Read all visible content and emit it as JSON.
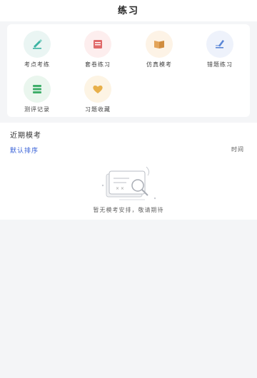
{
  "header": {
    "title": "练习"
  },
  "practice": {
    "tiles": [
      {
        "label": "考点考练",
        "icon": "pen-icon",
        "bg": "#eaf5f3",
        "color": "#3bb3a2"
      },
      {
        "label": "套卷练习",
        "icon": "book-icon",
        "bg": "#fdeeee",
        "color": "#e06a6a"
      },
      {
        "label": "仿真模考",
        "icon": "open-book-icon",
        "bg": "#fdf3e6",
        "color": "#e3a45a"
      },
      {
        "label": "错题练习",
        "icon": "edit-icon",
        "bg": "#eef2fb",
        "color": "#5a86d6"
      },
      {
        "label": "测评记录",
        "icon": "stack-icon",
        "bg": "#eaf6ee",
        "color": "#3fae6a"
      },
      {
        "label": "习题收藏",
        "icon": "heart-icon",
        "bg": "#fdf4e4",
        "color": "#e8b04a"
      }
    ]
  },
  "recent": {
    "title": "近期模考",
    "sort_label": "默认排序",
    "time_label": "时间",
    "empty_text": "暂无模考安排，敬请期待"
  }
}
